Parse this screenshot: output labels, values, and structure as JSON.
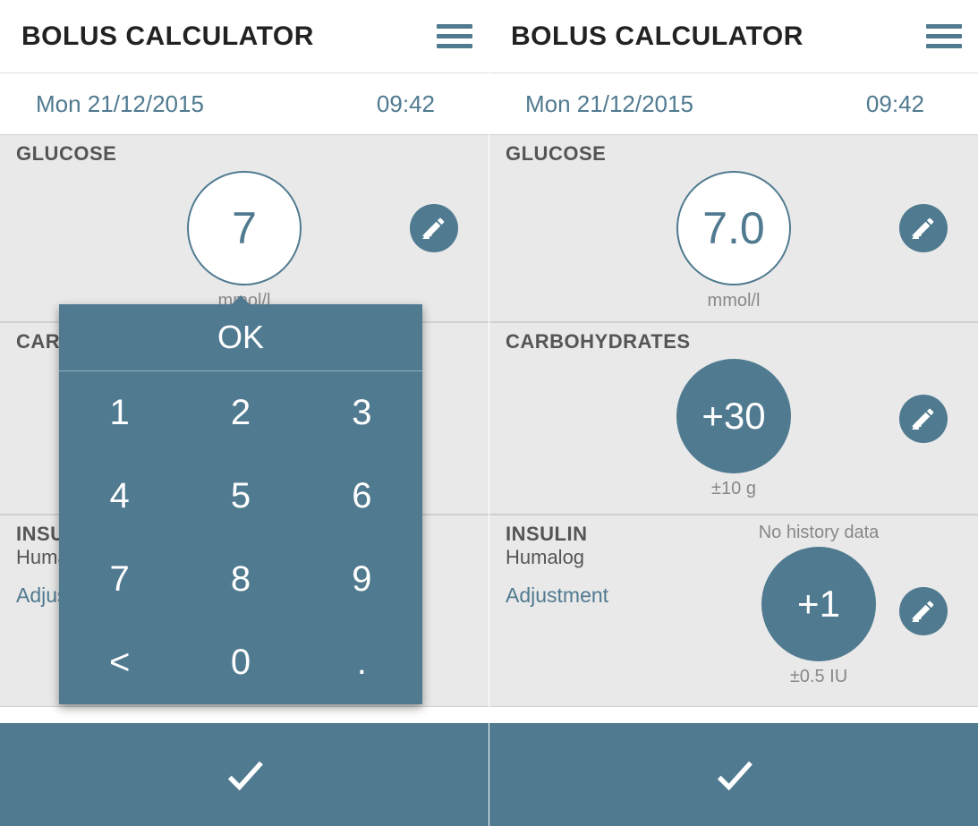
{
  "left": {
    "title": "BOLUS CALCULATOR",
    "date": "Mon 21/12/2015",
    "time": "09:42",
    "glucose_label": "GLUCOSE",
    "glucose_value": "7",
    "glucose_unit": "mmol/l",
    "carbs_label": "CARB",
    "insulin_label": "INSUL",
    "insulin_sub": "Huma",
    "insulin_link": "Adjus",
    "keypad": {
      "ok": "OK",
      "keys": [
        "1",
        "2",
        "3",
        "4",
        "5",
        "6",
        "7",
        "8",
        "9",
        "<",
        "0",
        "."
      ]
    }
  },
  "right": {
    "title": "BOLUS CALCULATOR",
    "date": "Mon 21/12/2015",
    "time": "09:42",
    "glucose_label": "GLUCOSE",
    "glucose_value": "7.0",
    "glucose_unit": "mmol/l",
    "carbs_label": "CARBOHYDRATES",
    "carbs_value": "+30",
    "carbs_unit": "±10 g",
    "insulin_label": "INSULIN",
    "insulin_sub": "Humalog",
    "insulin_link": "Adjustment",
    "insulin_history": "No history data",
    "insulin_value": "+1",
    "insulin_unit": "±0.5 IU"
  }
}
